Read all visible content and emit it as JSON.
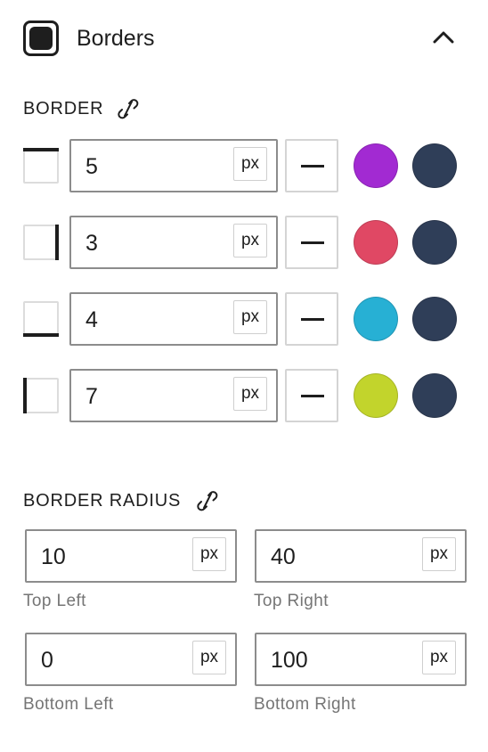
{
  "panel": {
    "title": "Borders",
    "icon": "border-style-icon",
    "toggle_icon": "chevron-up-icon"
  },
  "border": {
    "section_label": "BORDER",
    "link_icon": "unlinked-icon",
    "sides": [
      {
        "side": "top",
        "value": "5",
        "unit": "px",
        "style": "solid",
        "color": "#a22ad2",
        "secondary_color": "#2f3e58"
      },
      {
        "side": "right",
        "value": "3",
        "unit": "px",
        "style": "solid",
        "color": "#e04864",
        "secondary_color": "#2f3e58"
      },
      {
        "side": "bottom",
        "value": "4",
        "unit": "px",
        "style": "solid",
        "color": "#27b0d4",
        "secondary_color": "#2f3e58"
      },
      {
        "side": "left",
        "value": "7",
        "unit": "px",
        "style": "solid",
        "color": "#c2d42c",
        "secondary_color": "#2f3e58"
      }
    ]
  },
  "border_radius": {
    "section_label": "BORDER RADIUS",
    "link_icon": "unlinked-icon",
    "corners": [
      {
        "label": "Top Left",
        "value": "10",
        "unit": "px"
      },
      {
        "label": "Top Right",
        "value": "40",
        "unit": "px"
      },
      {
        "label": "Bottom Left",
        "value": "0",
        "unit": "px"
      },
      {
        "label": "Bottom Right",
        "value": "100",
        "unit": "px"
      }
    ]
  }
}
